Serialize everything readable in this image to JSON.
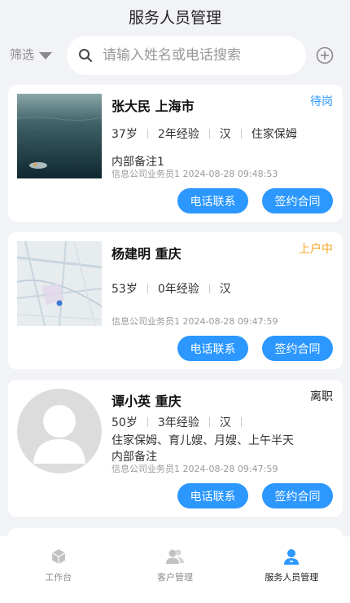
{
  "header": {
    "title": "服务人员管理"
  },
  "filter": {
    "label": "筛选"
  },
  "search": {
    "placeholder": "请输入姓名或电话搜索"
  },
  "cards": [
    {
      "name": "张大民 上海市",
      "status": "待岗",
      "status_color": "#2b97ff",
      "age": "37岁",
      "experience": "2年经验",
      "ethnicity": "汉",
      "skills": "住家保姆",
      "note": "内部备注1",
      "signoff": "信息公司业务员1 2024-08-28 09:48:53",
      "call_label": "电话联系",
      "sign_label": "签约合同"
    },
    {
      "name": "杨建明 重庆",
      "status": "上户中",
      "status_color": "#f5a623",
      "age": "53岁",
      "experience": "0年经验",
      "ethnicity": "汉",
      "signoff": "信息公司业务员1 2024-08-28 09:47:59",
      "call_label": "电话联系",
      "sign_label": "签约合同"
    },
    {
      "name": "谭小英 重庆",
      "status": "离职",
      "status_color": "#222222",
      "age": "50岁",
      "experience": "3年经验",
      "ethnicity": "汉",
      "skills": "住家保姆、育儿嫂、月嫂、上午半天",
      "note": "内部备注",
      "signoff": "信息公司业务员1 2024-08-28 09:47:59",
      "call_label": "电话联系",
      "sign_label": "签约合同"
    }
  ],
  "tabbar": {
    "tabs": [
      {
        "label": "工作台",
        "icon": "cube-icon"
      },
      {
        "label": "客户管理",
        "icon": "people-icon"
      },
      {
        "label": "服务人员管理",
        "icon": "person-icon"
      }
    ],
    "active_color": "#2b97ff"
  }
}
